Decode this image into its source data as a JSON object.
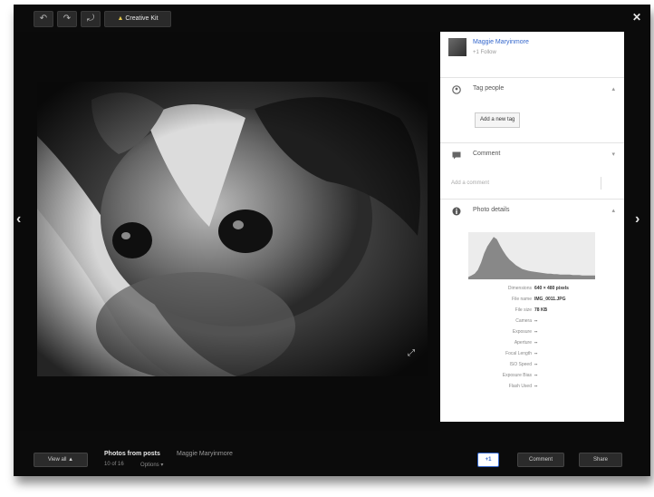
{
  "toolbar": {
    "undo_icon": "undo-icon",
    "redo_icon": "redo-icon",
    "rotate_icon": "rotate-icon",
    "creative_kit_label": "Creative Kit",
    "creative_kit_icon": "creative-kit-icon"
  },
  "owner": {
    "name": "Maggie Maryinmore",
    "meta": "+1 Follow"
  },
  "sections": {
    "tag_people": {
      "title": "Tag people",
      "button": "Add a new tag"
    },
    "comments": {
      "title": "Comment",
      "placeholder": "Add a comment"
    },
    "photo_details": {
      "title": "Photo details"
    }
  },
  "histogram": {
    "levels": [
      0.05,
      0.08,
      0.12,
      0.2,
      0.35,
      0.55,
      0.7,
      0.8,
      0.9,
      0.85,
      0.72,
      0.6,
      0.5,
      0.42,
      0.36,
      0.3,
      0.26,
      0.22,
      0.2,
      0.18,
      0.17,
      0.16,
      0.15,
      0.14,
      0.13,
      0.12,
      0.12,
      0.11,
      0.11,
      0.1,
      0.1,
      0.1,
      0.1,
      0.09,
      0.09,
      0.09,
      0.08,
      0.08,
      0.08,
      0.08
    ],
    "color": "#888888"
  },
  "details": [
    {
      "key": "Dimensions",
      "value": "640 × 480 pixels"
    },
    {
      "key": "File name",
      "value": "IMG_0011.JPG"
    },
    {
      "key": "File size",
      "value": "78 KB"
    },
    {
      "key": "Camera",
      "value": "--"
    },
    {
      "key": "Exposure",
      "value": "--"
    },
    {
      "key": "Aperture",
      "value": "--"
    },
    {
      "key": "Focal Length",
      "value": "--"
    },
    {
      "key": "ISO Speed",
      "value": "--"
    },
    {
      "key": "Exposure Bias",
      "value": "--"
    },
    {
      "key": "Flash Used",
      "value": "--"
    }
  ],
  "bottom": {
    "view_all_label": "View all ▲",
    "album_title": "Photos from posts",
    "album_owner": "Maggie Maryinmore",
    "counter": "10 of 16",
    "options_label": "Options ▾",
    "plus_one": "+1",
    "comment_label": "Comment",
    "share_label": "Share"
  },
  "colors": {
    "accent": "#3366cc",
    "background": "#0b0b0b"
  }
}
